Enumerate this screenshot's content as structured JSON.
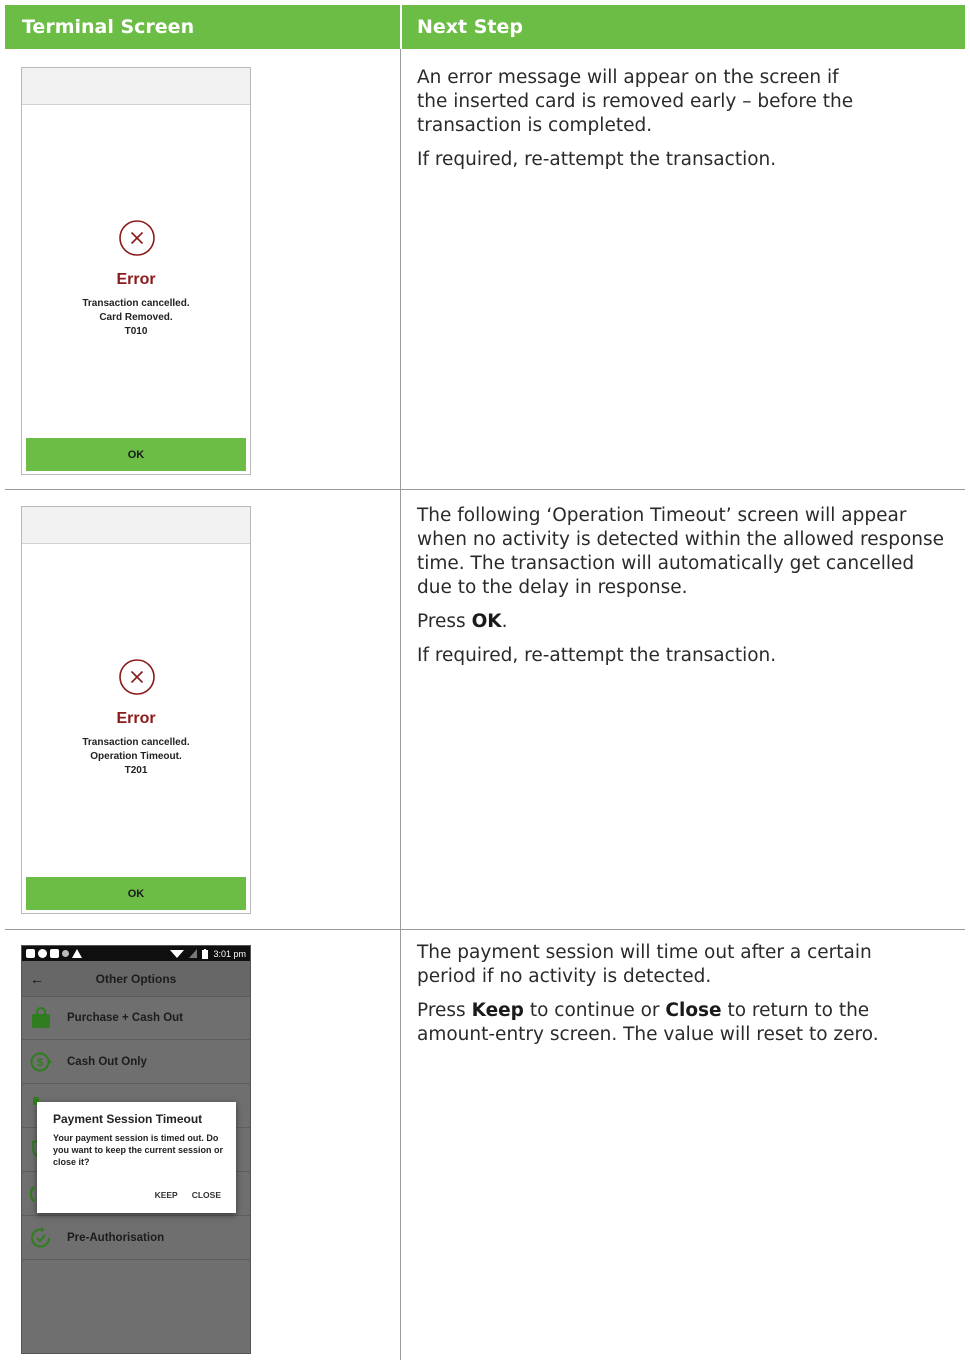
{
  "header": {
    "left": "Terminal Screen",
    "right": "Next Step"
  },
  "rows": [
    {
      "terminal": {
        "icon": "error-x-circle-icon",
        "title": "Error",
        "lines": [
          "Transaction cancelled.",
          "Card Removed.",
          "T010"
        ],
        "ok_label": "OK"
      },
      "next_step": {
        "p1": "An error message will appear on the screen if the inserted card is removed early – before the transaction is completed.",
        "p2": "If required, re-attempt the transaction."
      }
    },
    {
      "terminal": {
        "icon": "error-x-circle-icon",
        "title": "Error",
        "lines": [
          "Transaction cancelled.",
          "Operation Timeout.",
          "T201"
        ],
        "ok_label": "OK"
      },
      "next_step": {
        "p1": "The following ‘Operation Timeout’ screen will appear when no activity is detected within the allowed response time. The transaction will automatically get cancelled due to the delay in response.",
        "p2_pre": "Press ",
        "p2_bold": "OK",
        "p2_post": ".",
        "p3": "If required, re-attempt the transaction."
      }
    },
    {
      "phone": {
        "status_time": "3:01 pm",
        "appbar_title": "Other Options",
        "options": [
          {
            "label": "Purchase + Cash Out",
            "icon": "shopping-bag-icon"
          },
          {
            "label": "Cash Out Only",
            "icon": "cash-out-icon"
          },
          {
            "label": "Pre-Authorisation",
            "icon": "clock-check-icon"
          }
        ],
        "dialog": {
          "title": "Payment Session Timeout",
          "message": "Your payment session is timed out. Do you want to keep the current session or close it?",
          "keep_label": "KEEP",
          "close_label": "CLOSE"
        }
      },
      "next_step": {
        "p1": "The payment session will time out after a certain period if no activity is detected.",
        "p2_a": "Press ",
        "p2_keep": "Keep",
        "p2_b": " to continue or ",
        "p2_close": "Close",
        "p2_c": " to return to the amount-entry screen. The value will reset to zero."
      }
    }
  ],
  "colors": {
    "header_green": "#6cbd45",
    "button_green": "#6cbd45",
    "error_red": "#8b1a1a",
    "icon_green": "#2f7d1e"
  }
}
